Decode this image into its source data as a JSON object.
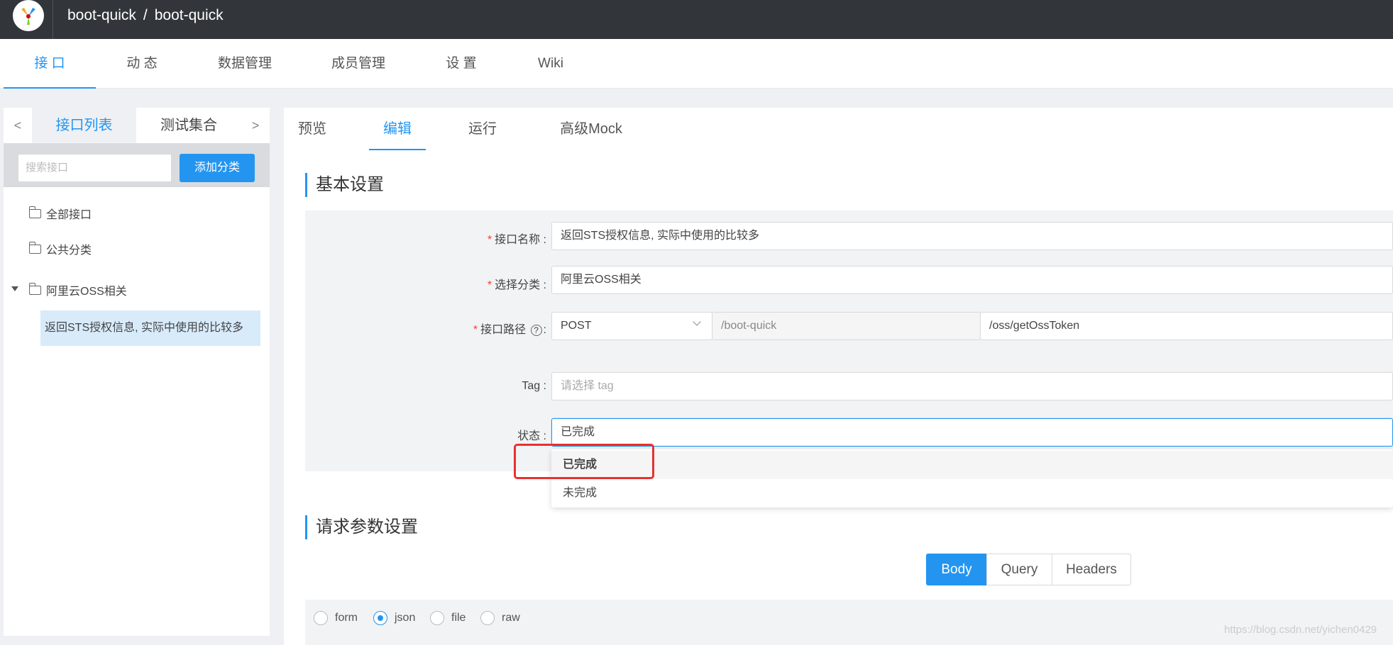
{
  "header": {
    "project_group": "boot-quick",
    "separator": "/",
    "project": "boot-quick"
  },
  "nav": {
    "items": [
      "接 口",
      "动 态",
      "数据管理",
      "成员管理",
      "设 置",
      "Wiki"
    ],
    "active": "接 口"
  },
  "left": {
    "prev_arrow": "<",
    "next_arrow": ">",
    "tab_api_list": "接口列表",
    "tab_test_collection": "测试集合",
    "search_placeholder": "搜索接口",
    "add_category_button": "添加分类",
    "tree": {
      "all": "全部接口",
      "public": "公共分类",
      "oss_group": "阿里云OSS相关",
      "oss_child": "返回STS授权信息, 实际中使用的比较多"
    }
  },
  "right": {
    "tabs": {
      "preview": "预览",
      "edit": "编辑",
      "run": "运行",
      "mock": "高级Mock"
    },
    "basic_section": "基本设置",
    "form": {
      "name_label": "接口名称 :",
      "name_value": "返回STS授权信息, 实际中使用的比较多",
      "category_label": "选择分类 :",
      "category_value": "阿里云OSS相关",
      "path_label": "接口路径",
      "path_help": "?",
      "path_colon": ":",
      "method": "POST",
      "base_path": "/boot-quick",
      "path_value": "/oss/getOssToken",
      "tag_label": "Tag :",
      "tag_placeholder": "请选择 tag",
      "status_label": "状态 :",
      "status_value": "已完成",
      "required_mark": "*"
    },
    "status_options": [
      "已完成",
      "未完成"
    ],
    "request_section": "请求参数设置",
    "request_tabs": [
      "Body",
      "Query",
      "Headers"
    ],
    "body_types": [
      "form",
      "json",
      "file",
      "raw"
    ],
    "body_type_selected": "json"
  },
  "watermark": "https://blog.csdn.net/yichen0429",
  "colors": {
    "accent": "#2395f1",
    "topbar": "#32363a",
    "highlight": "#e8312f",
    "required": "#f04134"
  }
}
